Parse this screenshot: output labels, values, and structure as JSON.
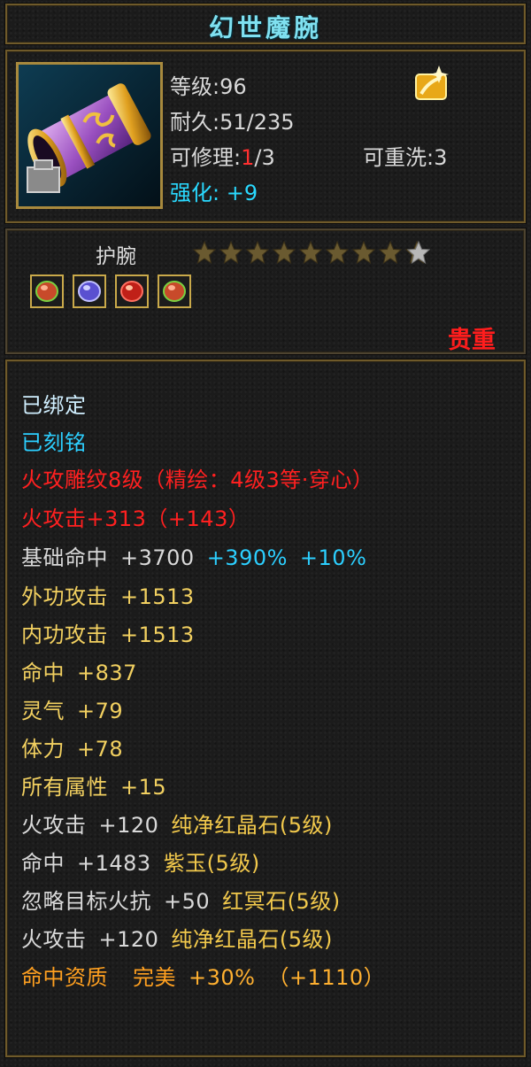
{
  "title": "幻世魔腕",
  "header": {
    "level_label": "等级:",
    "level_value": "96",
    "durability_label": "耐久:",
    "durability_value": "51/235",
    "repair_label": "可修理:",
    "repair_current": "1",
    "repair_total": "/3",
    "rewash_label": "可重洗:",
    "rewash_value": "3",
    "enhance_label": "强化:",
    "enhance_value": "+9"
  },
  "item": {
    "type": "护腕",
    "stars_lit": 9,
    "stars_total": 10,
    "rarity": "贵重",
    "gems": [
      "red-gem",
      "purple-gem",
      "red-gem",
      "red-gem"
    ]
  },
  "details": {
    "bound": "已绑定",
    "engraved": "已刻铭",
    "carving": "火攻雕纹8级（精绘：4级3等·穿心）",
    "fire_attack_label": "火攻击",
    "fire_attack_value": "+313",
    "fire_attack_bonus": "（+143）",
    "base_hit_label": "基础命中",
    "base_hit_value": "+3700",
    "base_hit_pct1": "+390%",
    "base_hit_pct2": "+10%",
    "stats": [
      {
        "label": "外功攻击",
        "value": "+1513"
      },
      {
        "label": "内功攻击",
        "value": "+1513"
      },
      {
        "label": "命中",
        "value": "+837"
      },
      {
        "label": "灵气",
        "value": "+79"
      },
      {
        "label": "体力",
        "value": "+78"
      },
      {
        "label": "所有属性",
        "value": "+15"
      }
    ],
    "gem_lines": [
      {
        "label": "火攻击",
        "value": "+120",
        "gem": "纯净红晶石(5级)"
      },
      {
        "label": "命中",
        "value": "+1483",
        "gem": "紫玉(5级)"
      },
      {
        "label": "忽略目标火抗",
        "value": "+50",
        "gem": "红冥石(5级)"
      },
      {
        "label": "火攻击",
        "value": "+120",
        "gem": "纯净红晶石(5级)"
      }
    ],
    "aptitude_label": "命中资质",
    "aptitude_grade": "完美",
    "aptitude_value": "+30%",
    "aptitude_bonus": "（+1110）"
  },
  "colors": {
    "frame_gold": "#6f5a2a",
    "title_cyan": "#7fe0f0",
    "rarity_red": "#ff1d1d",
    "stat_yellow": "#f2d060",
    "aptitude_orange": "#ffa020"
  }
}
